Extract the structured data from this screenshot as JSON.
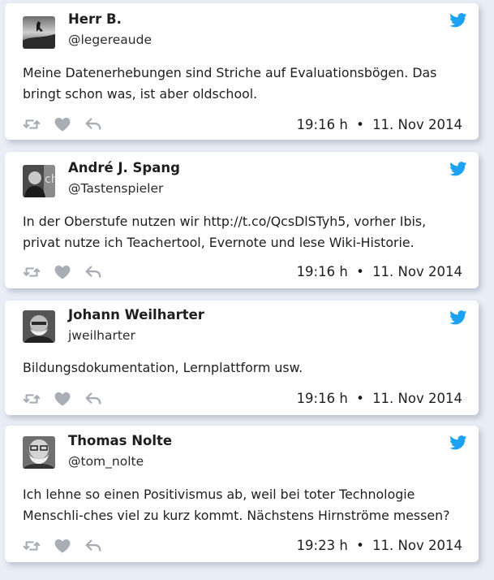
{
  "tweets": [
    {
      "name": "Herr B.",
      "handle": "@legereaude",
      "text": "Meine Datenerhebungen sind Striche auf Evaluationsbögen. Das bringt schon was, ist aber oldschool.",
      "time": "19:16 h",
      "date": "11. Nov 2014"
    },
    {
      "name": "André J. Spang",
      "handle": "@Tastenspieler",
      "text": "In der Oberstufe nutzen wir http://t.co/QcsDlSTyh5, vorher Ibis, privat nutze ich Teachertool, Evernote und lese Wiki-Historie.",
      "time": "19:16 h",
      "date": "11. Nov 2014"
    },
    {
      "name": "Johann Weilharter",
      "handle": "jweilharter",
      "text": "Bildungsdokumentation, Lernplattform usw.",
      "time": "19:16 h",
      "date": "11. Nov 2014"
    },
    {
      "name": "Thomas Nolte",
      "handle": "@tom_nolte",
      "text": "Ich lehne so einen Positivismus ab, weil bei toter Technologie Menschli-ches viel zu kurz kommt. Nächstens Hirnströme messen?",
      "time": "19:23 h",
      "date": "11. Nov 2014"
    }
  ],
  "separator": "•",
  "icons": {
    "brand": "twitter-bird-icon",
    "retweet": "retweet-icon",
    "like": "heart-icon",
    "reply": "reply-icon"
  },
  "colors": {
    "brand_blue": "#1da1f2",
    "action_gray": "#a9aeb6",
    "background": "#e9edf5"
  }
}
